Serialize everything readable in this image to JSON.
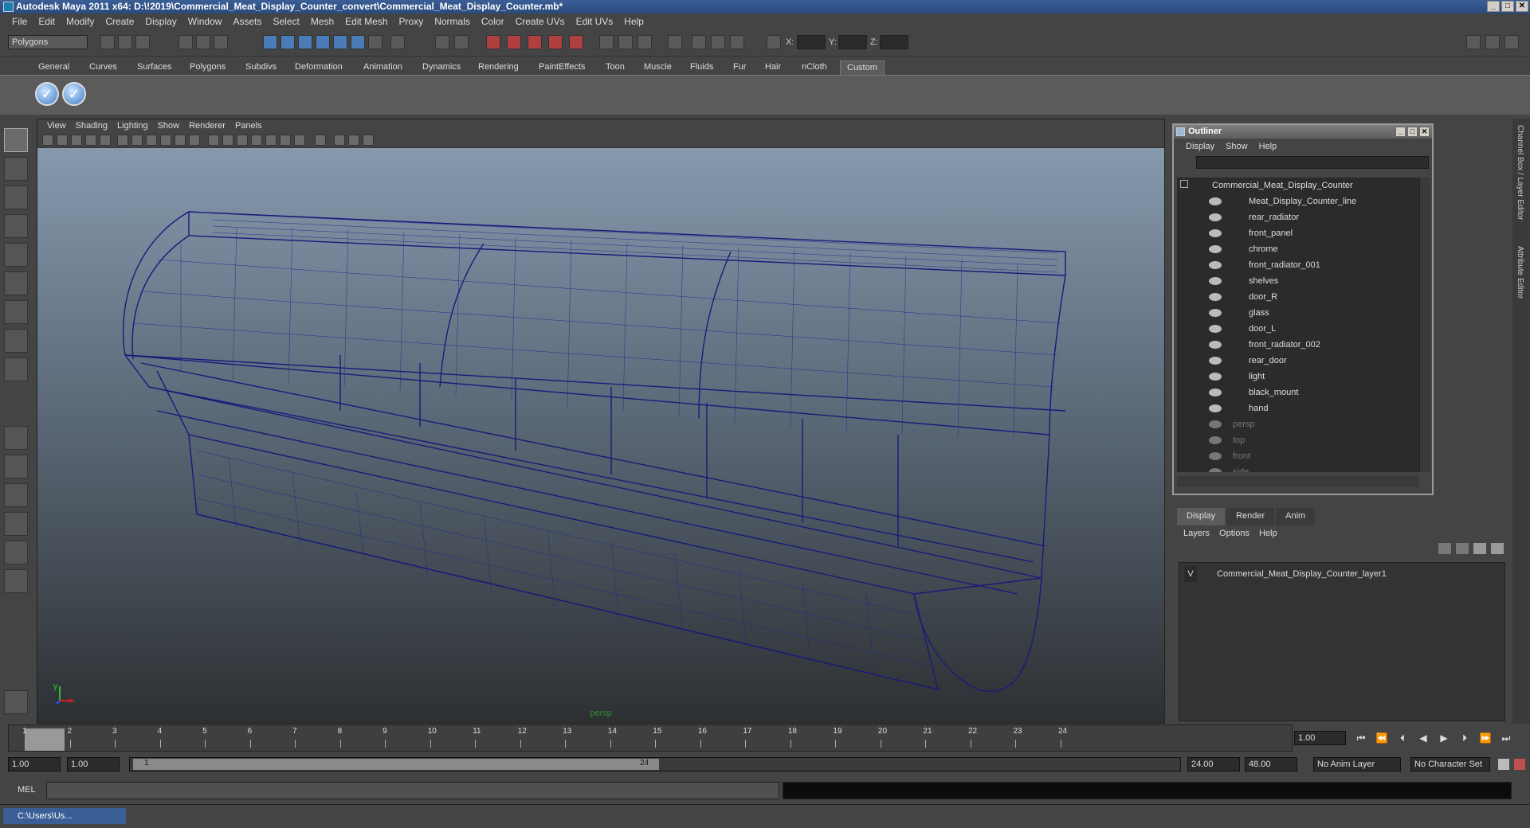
{
  "window": {
    "title": "Autodesk Maya 2011 x64: D:\\!2019\\Commercial_Meat_Display_Counter_convert\\Commercial_Meat_Display_Counter.mb*",
    "buttons": [
      "_",
      "□",
      "✕"
    ]
  },
  "menu": [
    "File",
    "Edit",
    "Modify",
    "Create",
    "Display",
    "Window",
    "Assets",
    "Select",
    "Mesh",
    "Edit Mesh",
    "Proxy",
    "Normals",
    "Color",
    "Create UVs",
    "Edit UVs",
    "Help"
  ],
  "status": {
    "mode": "Polygons",
    "x_label": "X:",
    "y_label": "Y:",
    "z_label": "Z:"
  },
  "shelf_tabs": [
    "General",
    "Curves",
    "Surfaces",
    "Polygons",
    "Subdivs",
    "Deformation",
    "Animation",
    "Dynamics",
    "Rendering",
    "PaintEffects",
    "Toon",
    "Muscle",
    "Fluids",
    "Fur",
    "Hair",
    "nCloth",
    "Custom"
  ],
  "shelf_active": "Custom",
  "viewport": {
    "menu": [
      "View",
      "Shading",
      "Lighting",
      "Show",
      "Renderer",
      "Panels"
    ],
    "camera": "persp",
    "axis_y": "y",
    "axis_x": "x"
  },
  "outliner": {
    "title": "Outliner",
    "menu": [
      "Display",
      "Show",
      "Help"
    ],
    "root": "Commercial_Meat_Display_Counter",
    "items": [
      "Meat_Display_Counter_line",
      "rear_radiator",
      "front_panel",
      "chrome",
      "front_radiator_001",
      "shelves",
      "door_R",
      "glass",
      "door_L",
      "front_radiator_002",
      "rear_door",
      "light",
      "black_mount",
      "hand"
    ],
    "cameras": [
      "persp",
      "top",
      "front",
      "side"
    ]
  },
  "layer_editor": {
    "tabs": [
      "Display",
      "Render",
      "Anim"
    ],
    "menu": [
      "Layers",
      "Options",
      "Help"
    ],
    "layer_visible": "V",
    "layer_name": "Commercial_Meat_Display_Counter_layer1"
  },
  "side_tabs": [
    "Channel Box / Layer Editor",
    "Attribute Editor"
  ],
  "timeline": {
    "ticks": [
      "1",
      "2",
      "3",
      "4",
      "5",
      "6",
      "7",
      "8",
      "9",
      "10",
      "11",
      "12",
      "13",
      "14",
      "15",
      "16",
      "17",
      "18",
      "19",
      "20",
      "21",
      "22",
      "23",
      "24"
    ],
    "current": "1",
    "current_field": "1.00"
  },
  "range": {
    "start": "1.00",
    "start2": "1.00",
    "slider_start": "1",
    "slider_end": "24",
    "end": "24.00",
    "end2": "48.00",
    "anim_layer": "No Anim Layer",
    "char_set": "No Character Set"
  },
  "mel": {
    "label": "MEL"
  },
  "taskbar": {
    "item": "C:\\Users\\Us..."
  }
}
